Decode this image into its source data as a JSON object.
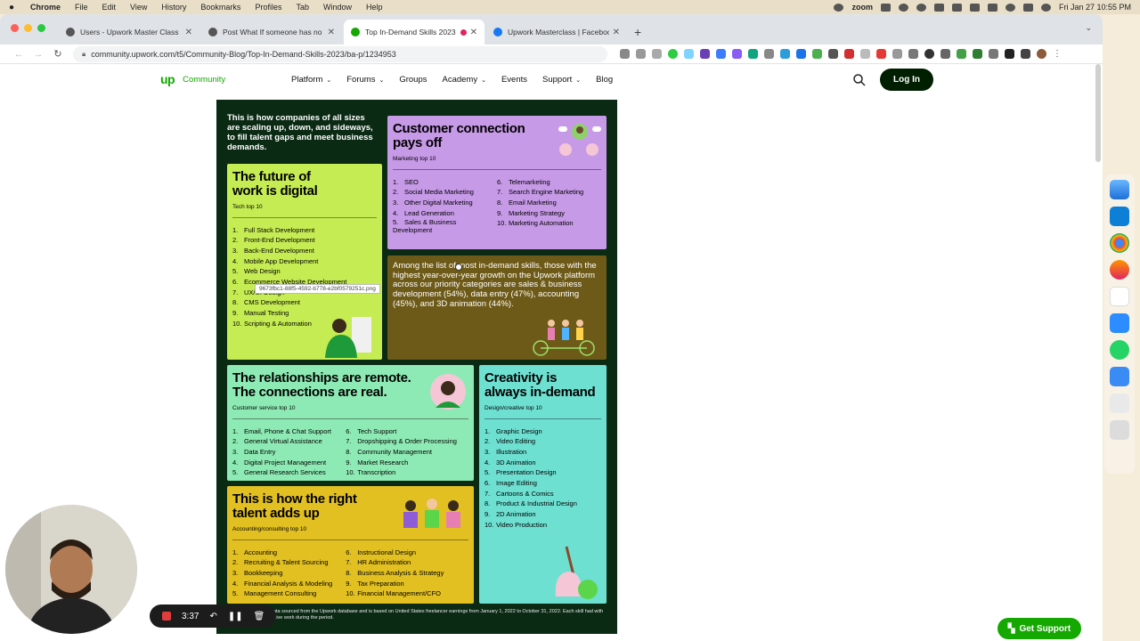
{
  "menubar": {
    "app": "Chrome",
    "items": [
      "File",
      "Edit",
      "View",
      "History",
      "Bookmarks",
      "Profiles",
      "Tab",
      "Window",
      "Help"
    ],
    "zoom_label": "zoom",
    "datetime": "Fri Jan 27  10:55 PM"
  },
  "tabs": [
    {
      "title": "Users - Upwork Master Class",
      "color": "#555555"
    },
    {
      "title": "Post What If someone has no s",
      "color": "#555555"
    },
    {
      "title": "Top In-Demand Skills 2023",
      "color": "#14a800"
    },
    {
      "title": "Upwork Masterclass | Faceboo",
      "color": "#1877f2"
    }
  ],
  "address_bar": {
    "url": "community.upwork.com/t5/Community-Blog/Top-In-Demand-Skills-2023/ba-p/1234953"
  },
  "site": {
    "logo": "up",
    "community": "Community",
    "nav": [
      {
        "label": "Platform",
        "dropdown": true
      },
      {
        "label": "Forums",
        "dropdown": true
      },
      {
        "label": "Groups",
        "dropdown": false
      },
      {
        "label": "Academy",
        "dropdown": true
      },
      {
        "label": "Events",
        "dropdown": false
      },
      {
        "label": "Support",
        "dropdown": true
      },
      {
        "label": "Blog",
        "dropdown": false
      }
    ],
    "login": "Log In",
    "support_button": "Get Support"
  },
  "infographic": {
    "intro": "This is how companies of all sizes are scaling up, down, and sideways, to fill talent gaps and meet business demands.",
    "customer": {
      "title": "Customer connection pays off",
      "subtitle": "Marketing top 10",
      "left": [
        "SEO",
        "Social Media Marketing",
        "Other Digital Marketing",
        "Lead Generation",
        "Sales & Business Development"
      ],
      "right": [
        "Telemarketing",
        "Search Engine Marketing",
        "Email Marketing",
        "Marketing Strategy",
        "Marketing Automation"
      ]
    },
    "tech": {
      "title": "The future of work is digital",
      "subtitle": "Tech top 10",
      "items": [
        "Full Stack Development",
        "Front-End Development",
        "Back-End Development",
        "Mobile App Development",
        "Web Design",
        "Ecommerce Website Development",
        "UX/UI Design",
        "CMS Development",
        "Manual Testing",
        "Scripting & Automation"
      ]
    },
    "growth": "Among the list of most in-demand skills, those with the highest year-over-year growth on the Upwork platform across our priority categories are sales & business development (54%), data entry (47%), accounting (45%), and 3D animation (44%).",
    "relationships": {
      "title": "The relationships are remote. The connections are real.",
      "subtitle": "Customer service top 10",
      "left": [
        "Email, Phone & Chat Support",
        "General Virtual Assistance",
        "Data Entry",
        "Digital Project Management",
        "General Research Services"
      ],
      "right": [
        "Tech Support",
        "Dropshipping & Order Processing",
        "Community Management",
        "Market Research",
        "Transcription"
      ]
    },
    "creativity": {
      "title": "Creativity is always in-demand",
      "subtitle": "Design/creative top 10",
      "items": [
        "Graphic Design",
        "Video Editing",
        "Illustration",
        "3D Animation",
        "Presentation Design",
        "Image Editing",
        "Cartoons & Comics",
        "Product & Industrial Design",
        "2D Animation",
        "Video Production"
      ]
    },
    "talent": {
      "title": "This is how the right talent adds up",
      "subtitle": "Accounting/consulting top 10",
      "left": [
        "Accounting",
        "Recruiting & Talent Sourcing",
        "Bookkeeping",
        "Financial Analysis & Modeling",
        "Management Consulting"
      ],
      "right": [
        "Instructional Design",
        "HR Administration",
        "Business Analysis & Strategy",
        "Tax Preparation",
        "Financial Management/CFO"
      ]
    },
    "footnote": "Data sourced from the Upwork database and is based on United States freelancer earnings from January 1, 2022 to October 31, 2022. Each skill had with active work during the period.",
    "tooltip": "9673fbc1-88f5-4592-b778-e2bf0579251c.png"
  },
  "recording": {
    "time": "3:37"
  }
}
